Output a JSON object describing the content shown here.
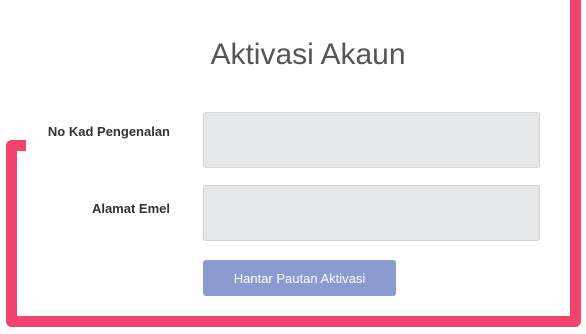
{
  "form": {
    "title": "Aktivasi Akaun",
    "ic_label": "No Kad Pengenalan",
    "ic_value": "",
    "email_label": "Alamat Emel",
    "email_value": "",
    "submit_label": "Hantar Pautan Aktivasi"
  },
  "colors": {
    "frame": "#f0436e",
    "button": "#8b9bd0",
    "input_bg": "#e6e7e8"
  }
}
